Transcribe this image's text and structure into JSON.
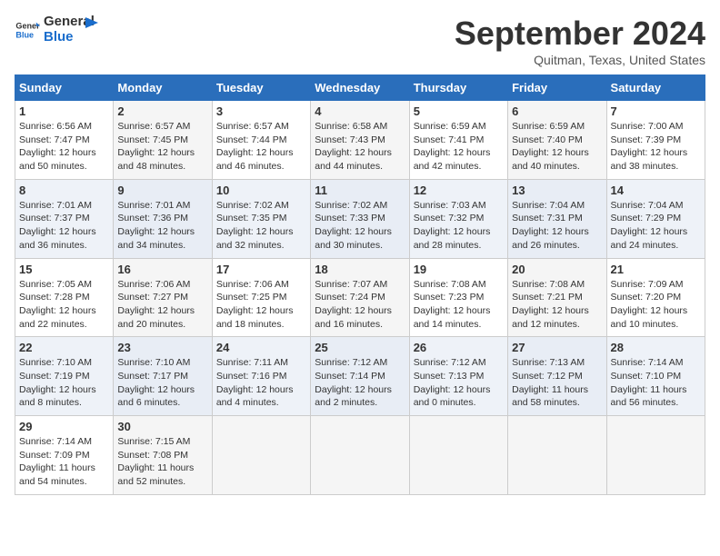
{
  "header": {
    "logo_line1": "General",
    "logo_line2": "Blue",
    "month_title": "September 2024",
    "location": "Quitman, Texas, United States"
  },
  "days_of_week": [
    "Sunday",
    "Monday",
    "Tuesday",
    "Wednesday",
    "Thursday",
    "Friday",
    "Saturday"
  ],
  "weeks": [
    [
      {
        "num": "1",
        "rise": "6:56 AM",
        "set": "7:47 PM",
        "daylight": "12 hours and 50 minutes."
      },
      {
        "num": "2",
        "rise": "6:57 AM",
        "set": "7:45 PM",
        "daylight": "12 hours and 48 minutes."
      },
      {
        "num": "3",
        "rise": "6:57 AM",
        "set": "7:44 PM",
        "daylight": "12 hours and 46 minutes."
      },
      {
        "num": "4",
        "rise": "6:58 AM",
        "set": "7:43 PM",
        "daylight": "12 hours and 44 minutes."
      },
      {
        "num": "5",
        "rise": "6:59 AM",
        "set": "7:41 PM",
        "daylight": "12 hours and 42 minutes."
      },
      {
        "num": "6",
        "rise": "6:59 AM",
        "set": "7:40 PM",
        "daylight": "12 hours and 40 minutes."
      },
      {
        "num": "7",
        "rise": "7:00 AM",
        "set": "7:39 PM",
        "daylight": "12 hours and 38 minutes."
      }
    ],
    [
      {
        "num": "8",
        "rise": "7:01 AM",
        "set": "7:37 PM",
        "daylight": "12 hours and 36 minutes."
      },
      {
        "num": "9",
        "rise": "7:01 AM",
        "set": "7:36 PM",
        "daylight": "12 hours and 34 minutes."
      },
      {
        "num": "10",
        "rise": "7:02 AM",
        "set": "7:35 PM",
        "daylight": "12 hours and 32 minutes."
      },
      {
        "num": "11",
        "rise": "7:02 AM",
        "set": "7:33 PM",
        "daylight": "12 hours and 30 minutes."
      },
      {
        "num": "12",
        "rise": "7:03 AM",
        "set": "7:32 PM",
        "daylight": "12 hours and 28 minutes."
      },
      {
        "num": "13",
        "rise": "7:04 AM",
        "set": "7:31 PM",
        "daylight": "12 hours and 26 minutes."
      },
      {
        "num": "14",
        "rise": "7:04 AM",
        "set": "7:29 PM",
        "daylight": "12 hours and 24 minutes."
      }
    ],
    [
      {
        "num": "15",
        "rise": "7:05 AM",
        "set": "7:28 PM",
        "daylight": "12 hours and 22 minutes."
      },
      {
        "num": "16",
        "rise": "7:06 AM",
        "set": "7:27 PM",
        "daylight": "12 hours and 20 minutes."
      },
      {
        "num": "17",
        "rise": "7:06 AM",
        "set": "7:25 PM",
        "daylight": "12 hours and 18 minutes."
      },
      {
        "num": "18",
        "rise": "7:07 AM",
        "set": "7:24 PM",
        "daylight": "12 hours and 16 minutes."
      },
      {
        "num": "19",
        "rise": "7:08 AM",
        "set": "7:23 PM",
        "daylight": "12 hours and 14 minutes."
      },
      {
        "num": "20",
        "rise": "7:08 AM",
        "set": "7:21 PM",
        "daylight": "12 hours and 12 minutes."
      },
      {
        "num": "21",
        "rise": "7:09 AM",
        "set": "7:20 PM",
        "daylight": "12 hours and 10 minutes."
      }
    ],
    [
      {
        "num": "22",
        "rise": "7:10 AM",
        "set": "7:19 PM",
        "daylight": "12 hours and 8 minutes."
      },
      {
        "num": "23",
        "rise": "7:10 AM",
        "set": "7:17 PM",
        "daylight": "12 hours and 6 minutes."
      },
      {
        "num": "24",
        "rise": "7:11 AM",
        "set": "7:16 PM",
        "daylight": "12 hours and 4 minutes."
      },
      {
        "num": "25",
        "rise": "7:12 AM",
        "set": "7:14 PM",
        "daylight": "12 hours and 2 minutes."
      },
      {
        "num": "26",
        "rise": "7:12 AM",
        "set": "7:13 PM",
        "daylight": "12 hours and 0 minutes."
      },
      {
        "num": "27",
        "rise": "7:13 AM",
        "set": "7:12 PM",
        "daylight": "11 hours and 58 minutes."
      },
      {
        "num": "28",
        "rise": "7:14 AM",
        "set": "7:10 PM",
        "daylight": "11 hours and 56 minutes."
      }
    ],
    [
      {
        "num": "29",
        "rise": "7:14 AM",
        "set": "7:09 PM",
        "daylight": "11 hours and 54 minutes."
      },
      {
        "num": "30",
        "rise": "7:15 AM",
        "set": "7:08 PM",
        "daylight": "11 hours and 52 minutes."
      },
      null,
      null,
      null,
      null,
      null
    ]
  ],
  "labels": {
    "sunrise": "Sunrise:",
    "sunset": "Sunset:",
    "daylight": "Daylight:"
  }
}
